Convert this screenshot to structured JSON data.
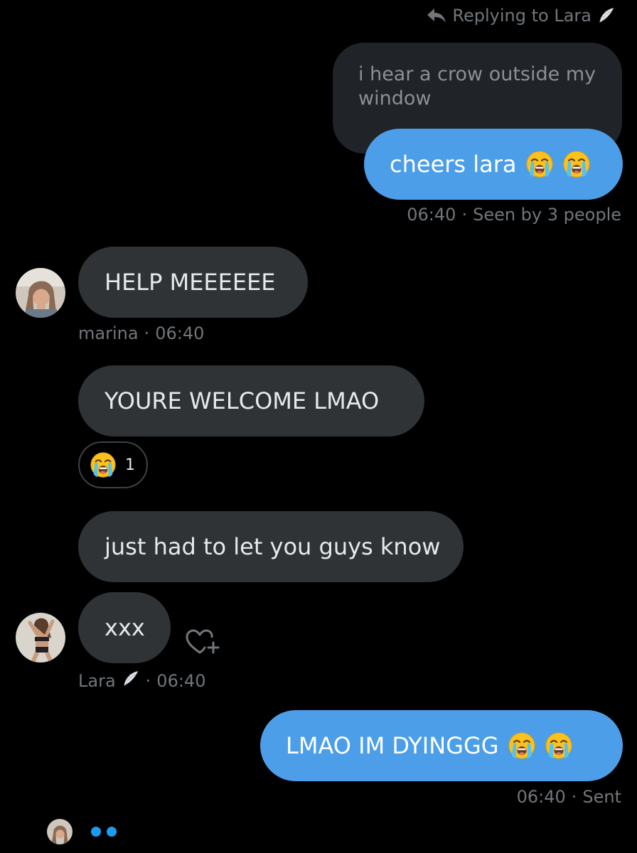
{
  "reply_context": {
    "label": "Replying to Lara",
    "icon": "reply-icon",
    "badge_icon": "angel-wing-icon"
  },
  "quoted_message": {
    "text": "i hear a crow outside my window"
  },
  "messages": [
    {
      "id": "m1",
      "sender": "me",
      "text": "cheers lara",
      "emojis": [
        "loudly-crying-face",
        "loudly-crying-face"
      ],
      "time": "06:40",
      "status": "Seen by 3 people"
    },
    {
      "id": "m2",
      "sender": "marina",
      "text": "HELP MEEEEEE",
      "sender_label": "marina",
      "time": "06:40"
    },
    {
      "id": "m3",
      "sender": "marina",
      "text": "YOURE WELCOME LMAO",
      "reaction": {
        "emoji": "loudly-crying-face",
        "count": "1"
      }
    },
    {
      "id": "m4",
      "sender": "marina",
      "text": "just had to let you guys know"
    },
    {
      "id": "m5",
      "sender": "Lara",
      "text": "xxx",
      "sender_label": "Lara",
      "sender_badge": "angel-wing-icon",
      "time": "06:40"
    },
    {
      "id": "m6",
      "sender": "me",
      "text": "LMAO IM DYINGGG",
      "emojis": [
        "loudly-crying-face",
        "loudly-crying-face"
      ],
      "time": "06:40",
      "status": "Sent"
    }
  ],
  "typing_indicator": {
    "dots": 2
  },
  "colors": {
    "background": "#000000",
    "bubble_received": "#2f3336",
    "bubble_sent": "#4c9ee8",
    "meta_text": "#71767b",
    "accent": "#1d9bf0"
  }
}
